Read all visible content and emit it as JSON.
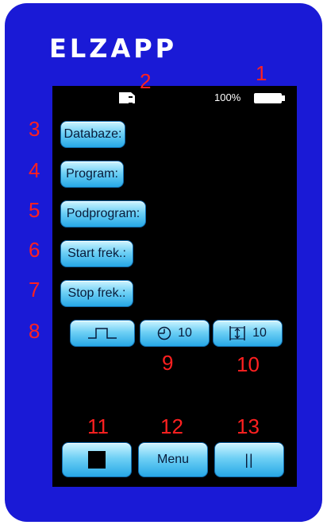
{
  "app": {
    "brand": "ELZAPP"
  },
  "status": {
    "battery_pct": "100%"
  },
  "fields": {
    "database": "Databaze:",
    "program": "Program:",
    "subprogram": "Podprogram:",
    "start_freq": "Start frek.:",
    "stop_freq": "Stop frek.:"
  },
  "controls": {
    "waveform": {
      "icon": "square-wave-icon"
    },
    "timer": {
      "icon": "clock-icon",
      "value": "10"
    },
    "amplitude": {
      "icon": "amplitude-icon",
      "value": "10"
    },
    "stop": {
      "icon": "stop-square-icon"
    },
    "menu": "Menu",
    "pause": "||"
  },
  "annotations": [
    "1",
    "2",
    "3",
    "4",
    "5",
    "6",
    "7",
    "8",
    "9",
    "10",
    "11",
    "12",
    "13"
  ],
  "colors": {
    "device_body": "#1a1ad6",
    "screen": "#000000",
    "button_gradient_top": "#cdf4ff",
    "button_gradient_bottom": "#27a8e6",
    "annotation": "#ff2020"
  }
}
